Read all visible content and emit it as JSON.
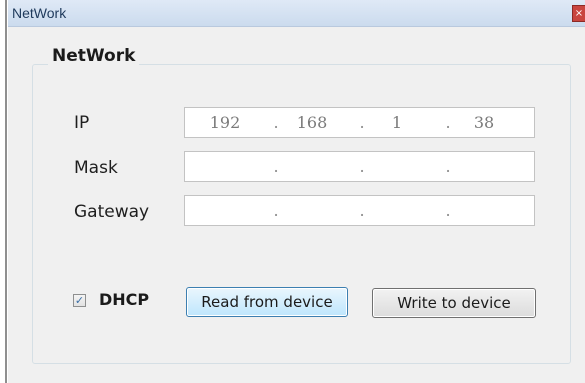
{
  "window": {
    "title": "NetWork",
    "close_glyph": "×"
  },
  "group": {
    "title": "NetWork"
  },
  "fields": [
    {
      "label": "IP",
      "octets": [
        "192",
        "168",
        "1",
        "38"
      ]
    },
    {
      "label": "Mask",
      "octets": [
        "",
        "",
        "",
        ""
      ]
    },
    {
      "label": "Gateway",
      "octets": [
        "",
        "",
        "",
        ""
      ]
    }
  ],
  "separator": ".",
  "dhcp": {
    "label": "DHCP",
    "checked": true,
    "check_glyph": "✓"
  },
  "buttons": {
    "read_label": "Read from device",
    "write_label": "Write to device"
  }
}
